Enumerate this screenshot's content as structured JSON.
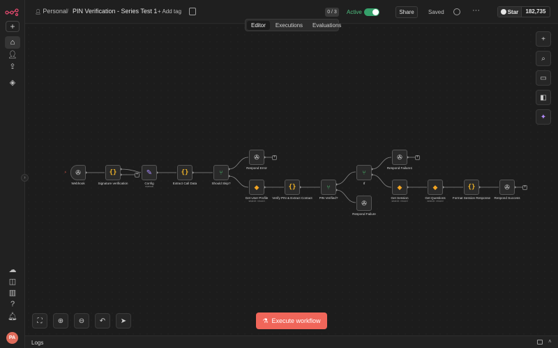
{
  "topbar": {
    "breadcrumb_owner": "Personal",
    "separator": "/",
    "workflow_name": "PIN Verification - Series Test 1",
    "add_tag": "+ Add tag",
    "counter": "0 / 3",
    "active_label": "Active",
    "share": "Share",
    "saved": "Saved",
    "more": "···",
    "github_star": "Star",
    "github_count": "182,735"
  },
  "tabs": [
    {
      "label": "Editor",
      "active": true
    },
    {
      "label": "Executions",
      "active": false
    },
    {
      "label": "Evaluations",
      "active": false
    }
  ],
  "sidebar": {
    "avatar_initials": "PA",
    "icons": [
      "logo-icon",
      "plus-icon",
      "home-icon",
      "user-icon",
      "share-icon",
      "layers-icon",
      "cloud-icon",
      "template-icon",
      "insights-icon",
      "help-icon",
      "bell-icon"
    ]
  },
  "nodes": {
    "webhook": {
      "label": "Webhook",
      "sub": ""
    },
    "sig": {
      "label": "Signature verification",
      "sub": ""
    },
    "config": {
      "label": "Config",
      "sub": "manual"
    },
    "extract": {
      "label": "Extract Call Data",
      "sub": ""
    },
    "should_skip": {
      "label": "Should Skip?",
      "sub": ""
    },
    "respond_error": {
      "label": "Respond Error",
      "sub": ""
    },
    "get_user": {
      "label": "Get User Profile",
      "sub": "search: record"
    },
    "verify_pin": {
      "label": "Verify PIN & Extract Contact",
      "sub": ""
    },
    "pin_verified": {
      "label": "PIN Verified?",
      "sub": ""
    },
    "if": {
      "label": "If",
      "sub": ""
    },
    "respond_failure": {
      "label": "Respond Failure",
      "sub": ""
    },
    "respond_failure1": {
      "label": "Respond Failure1",
      "sub": ""
    },
    "get_session": {
      "label": "Get Session",
      "sub": "search: record"
    },
    "get_questions": {
      "label": "Get Questions",
      "sub": "search: record"
    },
    "format_session": {
      "label": "Format Session Response",
      "sub": ""
    },
    "respond_success": {
      "label": "Respond Success",
      "sub": ""
    }
  },
  "controls": {
    "execute": "Execute workflow",
    "logs": "Logs"
  },
  "colors": {
    "accent": "#f0665a",
    "active_green": "#35a06a",
    "code_icon": "#f0b429",
    "if_icon": "#49b86c"
  }
}
